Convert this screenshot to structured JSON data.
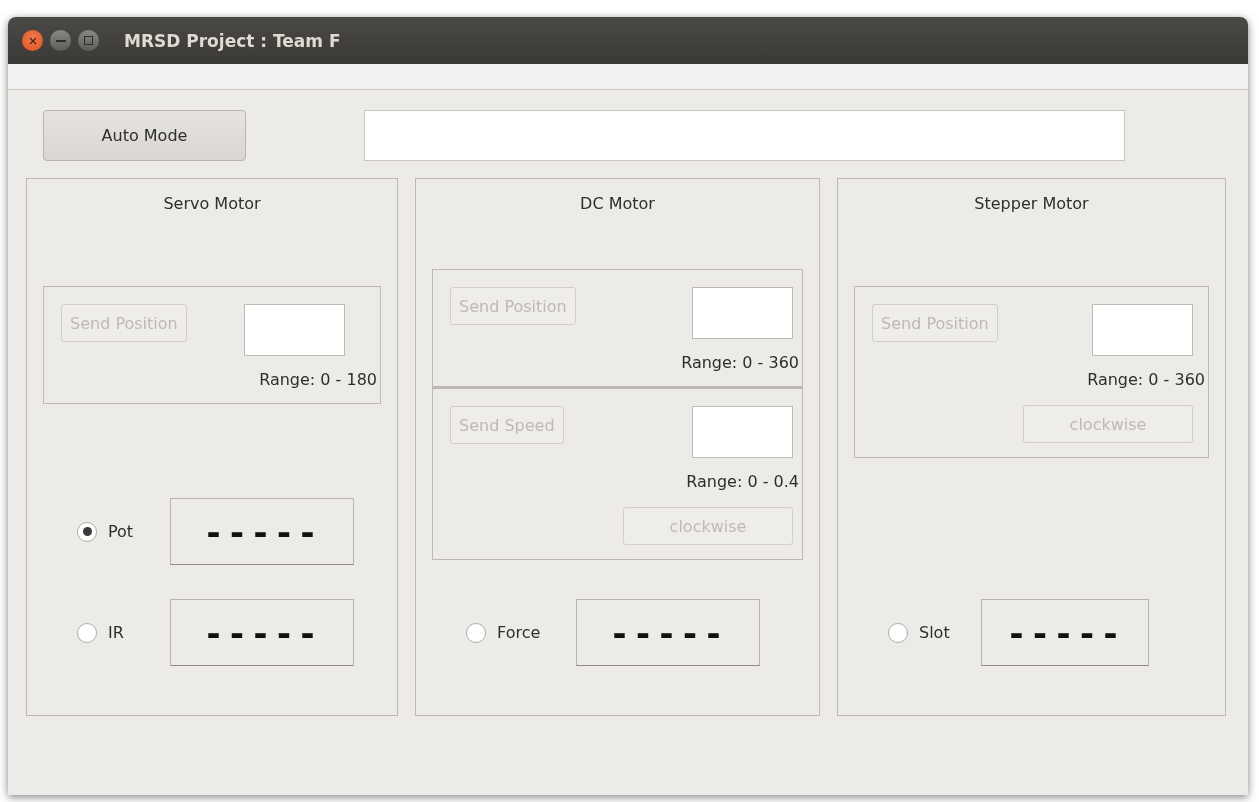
{
  "window": {
    "title": "MRSD Project : Team F"
  },
  "auto_mode_button": {
    "label": "Auto Mode"
  },
  "motors": [
    {
      "title": "Servo Motor",
      "panels": [
        {
          "rows": [
            {
              "kind": "send",
              "button": "Send Position",
              "disabled": true,
              "range": "Range: 0 - 180"
            }
          ]
        }
      ],
      "sensors": [
        {
          "label": "Pot",
          "selected": true,
          "reading": "-----"
        },
        {
          "label": "IR",
          "selected": false,
          "reading": "-----"
        }
      ]
    },
    {
      "title": "DC Motor",
      "panels": [
        {
          "rows": [
            {
              "kind": "send",
              "button": "Send Position",
              "disabled": true,
              "range": "Range: 0 - 360"
            }
          ]
        },
        {
          "rows": [
            {
              "kind": "send",
              "button": "Send Speed",
              "disabled": true,
              "range": "Range: 0 - 0.4"
            },
            {
              "kind": "direction",
              "button": "clockwise",
              "disabled": true
            }
          ]
        }
      ],
      "sensors": [
        {
          "label": "Force",
          "selected": false,
          "reading": "-----"
        }
      ]
    },
    {
      "title": "Stepper Motor",
      "panels": [
        {
          "rows": [
            {
              "kind": "send",
              "button": "Send Position",
              "disabled": true,
              "range": "Range: 0 - 360"
            },
            {
              "kind": "direction",
              "button": "clockwise",
              "disabled": true
            }
          ]
        }
      ],
      "sensors": [
        {
          "label": "Slot",
          "selected": false,
          "reading": "-----"
        }
      ]
    }
  ]
}
